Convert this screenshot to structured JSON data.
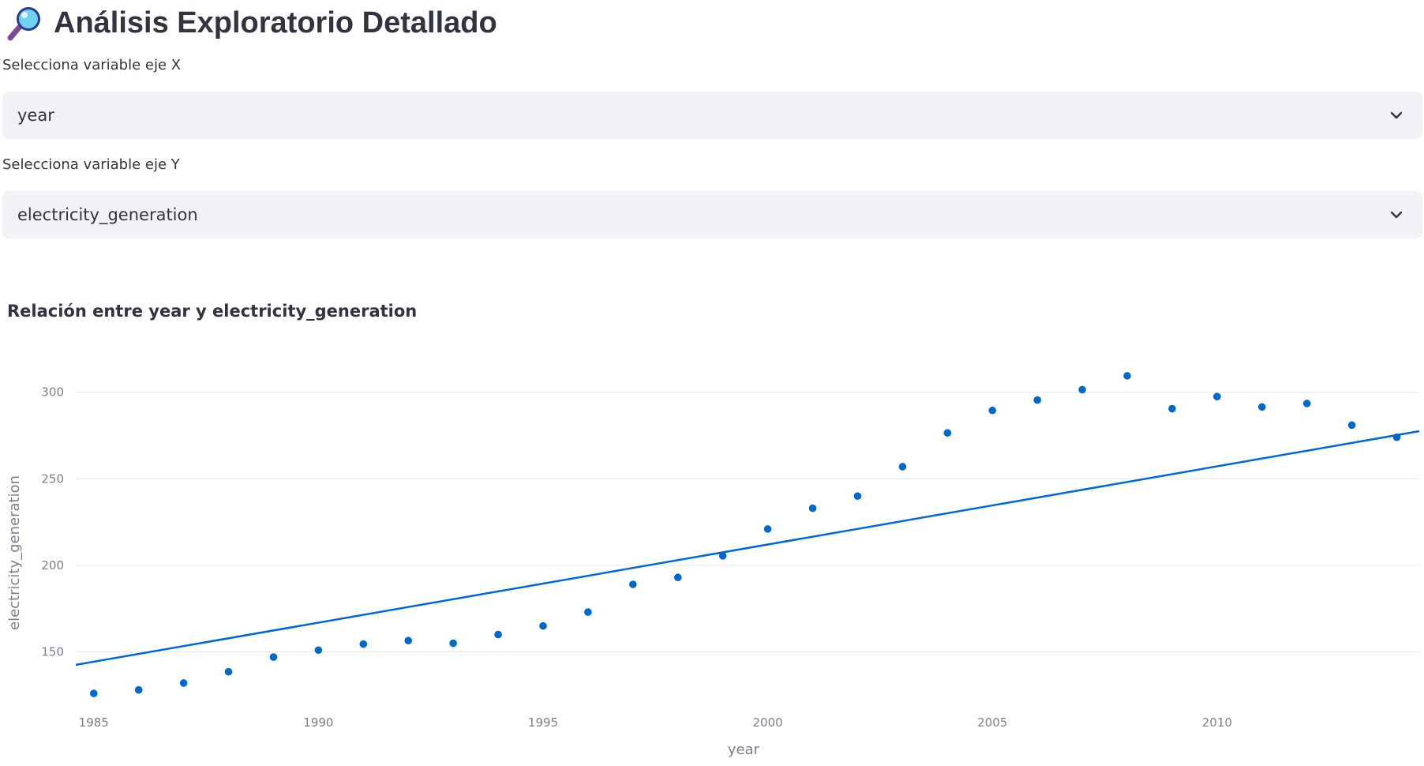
{
  "header": {
    "title": "Análisis Exploratorio Detallado",
    "icon": "magnifying-glass-icon"
  },
  "controls": {
    "x_select": {
      "label": "Selecciona variable eje X",
      "value": "year"
    },
    "y_select": {
      "label": "Selecciona variable eje Y",
      "value": "electricity_generation"
    }
  },
  "chart_title": "Relación entre year y electricity_generation",
  "colors": {
    "accent": "#0068c9",
    "grid": "#e6e9ef",
    "tick": "#7a7f8c",
    "select_bg": "#f0f2f6"
  },
  "chart_data": {
    "type": "scatter",
    "title": "Relación entre year y electricity_generation",
    "xlabel": "year",
    "ylabel": "electricity_generation",
    "xlim": [
      1984.6,
      2014.5
    ],
    "ylim": [
      116,
      335
    ],
    "x_ticks": [
      1985,
      1990,
      1995,
      2000,
      2005,
      2010
    ],
    "y_ticks": [
      150,
      200,
      250,
      300
    ],
    "grid": true,
    "series": [
      {
        "kind": "points",
        "x": [
          1985,
          1986,
          1987,
          1988,
          1989,
          1990,
          1991,
          1992,
          1993,
          1994,
          1995,
          1996,
          1997,
          1998,
          1999,
          2000,
          2001,
          2002,
          2003,
          2004,
          2005,
          2006,
          2007,
          2008,
          2009,
          2010,
          2011,
          2012,
          2013,
          2014
        ],
        "y": [
          126,
          128,
          132,
          138.5,
          147,
          151,
          154.5,
          156.5,
          155,
          160,
          165,
          173,
          189,
          193,
          205.5,
          221,
          233,
          240,
          257,
          276.5,
          289.5,
          295.5,
          301.5,
          309.5,
          290.5,
          297.5,
          291.5,
          293.5,
          281,
          274
        ]
      },
      {
        "kind": "trendline",
        "x": [
          1984.6,
          2014.5
        ],
        "y": [
          142.5,
          277.5
        ]
      }
    ]
  }
}
